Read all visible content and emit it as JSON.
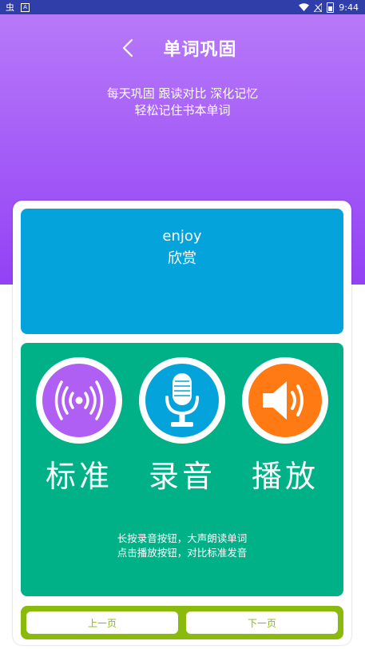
{
  "status_bar": {
    "time": "9:44",
    "notif_glyph": "虫",
    "notif_box": "A"
  },
  "header": {
    "title": "单词巩固",
    "subtitle_line1": "每天巩固  跟读对比  深化记忆",
    "subtitle_line2": "轻松记住书本单词"
  },
  "word": {
    "english": "enjoy",
    "chinese": "欣赏"
  },
  "actions": [
    {
      "label": "标准",
      "icon": "broadcast-icon",
      "color": "#b05ff5"
    },
    {
      "label": "录音",
      "icon": "microphone-icon",
      "color": "#05a3db"
    },
    {
      "label": "播放",
      "icon": "speaker-icon",
      "color": "#ff7a12"
    }
  ],
  "hints": {
    "line1": "长按录音按钮，大声朗读单词",
    "line2": "点击播放按钮，对比标准发音"
  },
  "nav": {
    "prev_label": "上一页",
    "next_label": "下一页"
  },
  "colors": {
    "header_top": "#b97cf8",
    "header_bottom": "#9341f5",
    "word_panel": "#05a3db",
    "action_panel": "#00b087",
    "nav_panel": "#8aba0c"
  }
}
